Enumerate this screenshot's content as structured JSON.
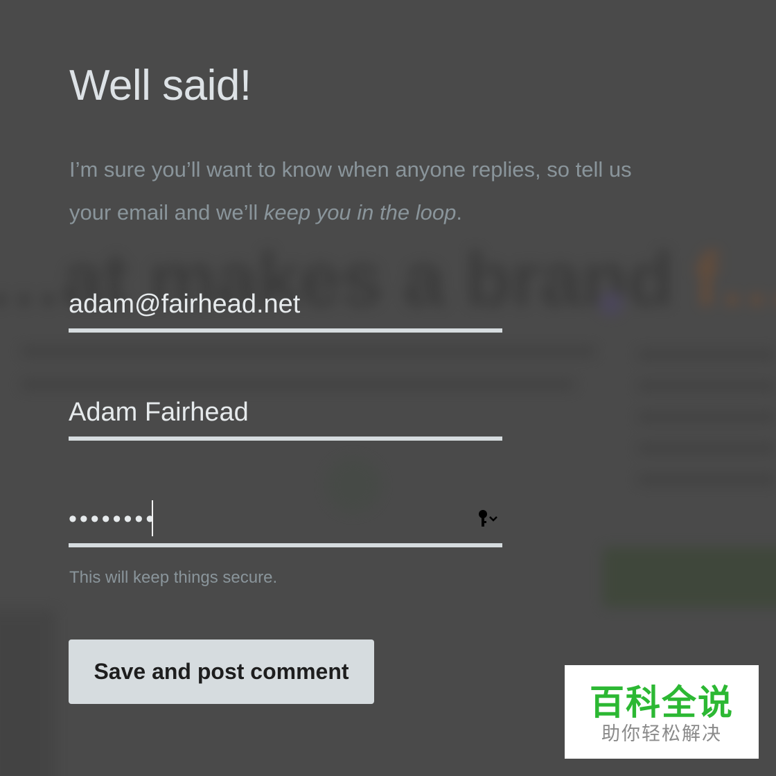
{
  "dialog": {
    "title": "Well said!",
    "intro_plain": "I’m sure you’ll want to know when anyone replies, so tell us your email and we’ll ",
    "intro_emphasis": "keep you in the loop",
    "intro_end": "."
  },
  "form": {
    "email_value": "adam@fairhead.net",
    "name_value": "Adam Fairhead",
    "password_value": "••••••••",
    "password_hint": "This will keep things secure.",
    "submit_label": "Save and post comment"
  },
  "background": {
    "headline_dark": "…at makes a brand ",
    "headline_accent": "f…"
  },
  "watermark": {
    "main": "百科全说",
    "sub": "助你轻松解决"
  },
  "colors": {
    "overlay": "#4a4a4a",
    "heading": "#dde2e6",
    "muted": "#8a959b",
    "underline": "#d6dcdf",
    "button_bg": "#d6dcdf",
    "watermark_green": "#2cb833"
  },
  "icons": {
    "password_manager": "key-with-chevron-icon"
  }
}
